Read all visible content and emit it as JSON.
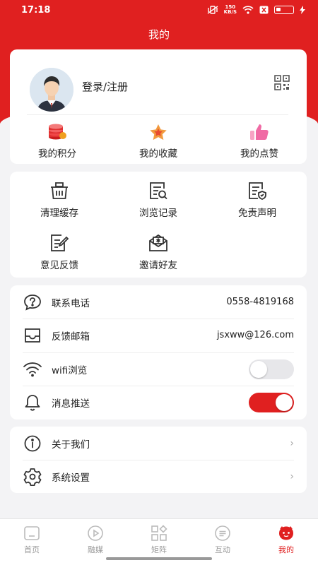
{
  "status": {
    "time": "17:18",
    "net_speed_top": "150",
    "net_speed_bottom": "KB/S"
  },
  "page": {
    "title": "我的"
  },
  "profile": {
    "login_label": "登录/注册",
    "stats": [
      {
        "label": "我的积分",
        "icon": "coins-icon"
      },
      {
        "label": "我的收藏",
        "icon": "star-icon"
      },
      {
        "label": "我的点赞",
        "icon": "thumbs-up-icon"
      }
    ]
  },
  "tools": [
    {
      "label": "清理缓存",
      "icon": "basket-icon"
    },
    {
      "label": "浏览记录",
      "icon": "history-icon"
    },
    {
      "label": "免责声明",
      "icon": "disclaimer-icon"
    },
    {
      "label": "意见反馈",
      "icon": "feedback-icon"
    },
    {
      "label": "邀请好友",
      "icon": "invite-icon"
    }
  ],
  "settings": {
    "phone_label": "联系电话",
    "phone_value": "0558-4819168",
    "email_label": "反馈邮箱",
    "email_value": "jsxww@126.com",
    "wifi_label": "wifi浏览",
    "wifi_enabled": false,
    "push_label": "消息推送",
    "push_enabled": true
  },
  "about": {
    "about_label": "关于我们",
    "settings_label": "系统设置"
  },
  "tabbar": [
    {
      "label": "首页",
      "icon": "home-icon"
    },
    {
      "label": "融媒",
      "icon": "play-icon"
    },
    {
      "label": "矩阵",
      "icon": "grid-icon"
    },
    {
      "label": "互动",
      "icon": "chat-icon"
    },
    {
      "label": "我的",
      "icon": "profile-icon"
    }
  ],
  "colors": {
    "accent": "#e02020",
    "background": "#f3f3f5"
  }
}
